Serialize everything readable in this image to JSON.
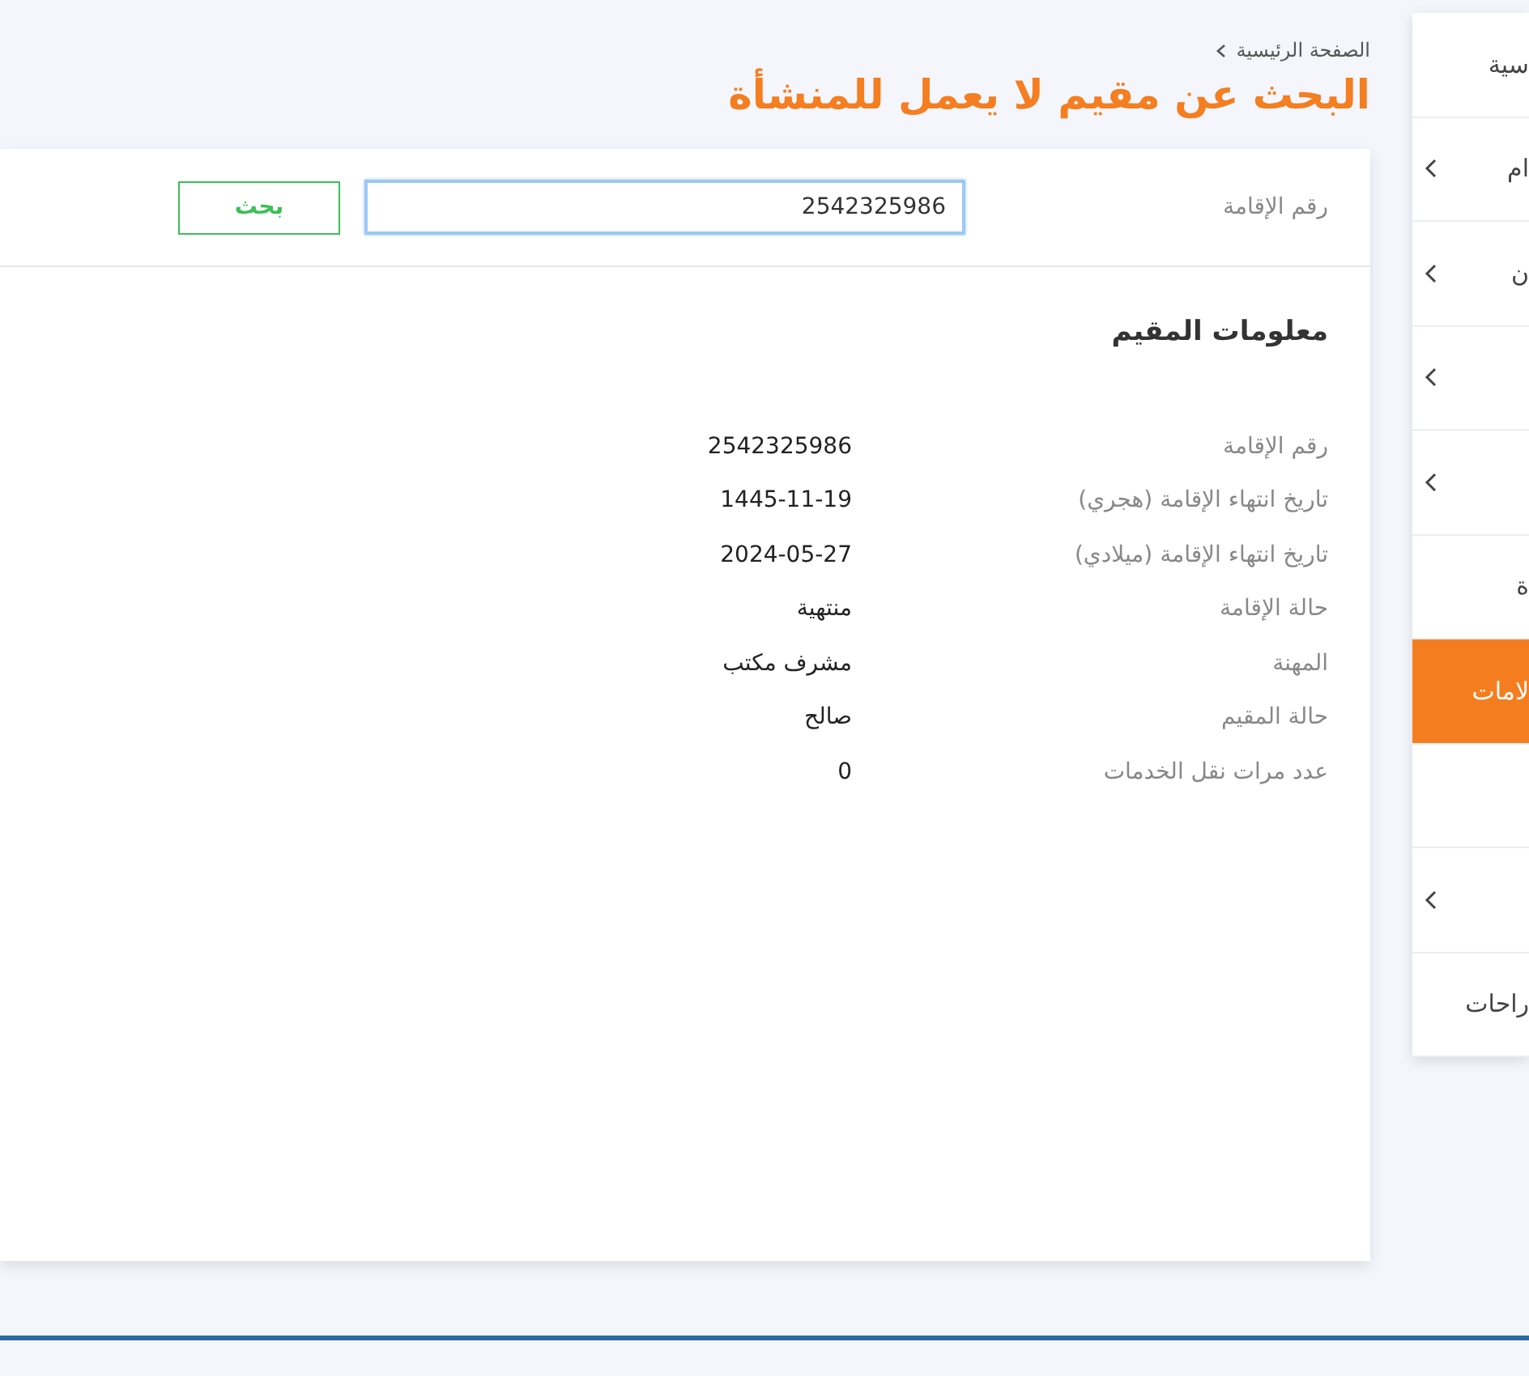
{
  "breadcrumb": {
    "items": [
      "الصفحة الرئيسية"
    ]
  },
  "page_title": "البحث عن مقيم لا يعمل للمنشأة",
  "search_form": {
    "label": "رقم الإقامة",
    "value": "2542325986",
    "button": "بحث"
  },
  "resident_info": {
    "title": "معلومات المقيم",
    "fields": [
      {
        "label": "رقم الإقامة",
        "value": "2542325986"
      },
      {
        "label": "تاريخ انتهاء الإقامة (هجري)",
        "value": "1445-11-19"
      },
      {
        "label": "تاريخ انتهاء الإقامة (ميلادي)",
        "value": "2024-05-27"
      },
      {
        "label": "حالة الإقامة",
        "value": "منتهية"
      },
      {
        "label": "المهنة",
        "value": "مشرف مكتب"
      },
      {
        "label": "حالة المقيم",
        "value": "صالح"
      },
      {
        "label": "عدد مرات نقل الخدمات",
        "value": "0"
      }
    ]
  },
  "sidebar": {
    "items": [
      {
        "label": "سية",
        "expandable": false,
        "selected": false
      },
      {
        "label": "ام",
        "expandable": true,
        "selected": false
      },
      {
        "label": "ن",
        "expandable": true,
        "selected": false
      },
      {
        "expandable": true,
        "selected": false
      },
      {
        "expandable": true,
        "selected": false
      },
      {
        "label": "ة",
        "expandable": false,
        "selected": false
      },
      {
        "label": "لامات",
        "expandable": false,
        "selected": true
      },
      {
        "expandable": false,
        "selected": false
      },
      {
        "expandable": true,
        "selected": false
      },
      {
        "label": "راحات",
        "expandable": false,
        "selected": false
      }
    ]
  }
}
